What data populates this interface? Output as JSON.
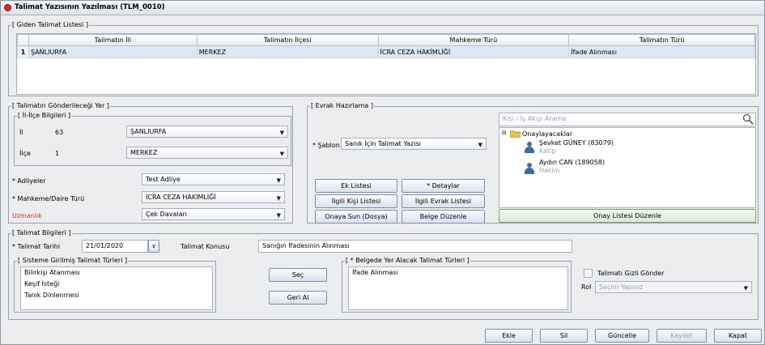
{
  "window": {
    "title": "Talimat Yazısının Yazılması (TLM_0010)"
  },
  "outgoing": {
    "title": "[ Giden Talimat Listesi ]",
    "columns": [
      "Talimatın İli",
      "Talimatın İlçesi",
      "Mahkeme Türü",
      "Talimatın Türü"
    ],
    "rows": [
      {
        "num": "1",
        "cells": [
          "ŞANLIURFA",
          "MERKEZ",
          "İCRA CEZA HAKİMLİĞİ",
          "İfade Alınması"
        ]
      }
    ]
  },
  "destination": {
    "title": "[ Talimatın Gönderileceği Yer ]",
    "ilce_group_title": "[ İl-İlçe Bilgileri ]",
    "il_label": "İl",
    "il_code": "63",
    "il_value": "ŞANLIURFA",
    "ilce_label": "İlçe",
    "ilce_code": "1",
    "ilce_value": "MERKEZ",
    "adliye_label": "* Adliyeler",
    "adliye_value": "Test Adliye",
    "mahkeme_label": "* Mahkeme/Daire Türü",
    "mahkeme_value": "İCRA CEZA HAKİMLİĞİ",
    "uzmanlik_label": "Uzmanlık",
    "uzmanlik_value": "Çek Davaları"
  },
  "evrak": {
    "title": "[ Evrak Hazırlama ]",
    "sablon_label": "* Şablon",
    "sablon_value": "Sanık İçin Talimat Yazısı",
    "buttons": {
      "ek_listesi": "Ek Listesi",
      "detaylar": "* Detaylar",
      "ilgili_kisi": "İlgili Kişi Listesi",
      "ilgili_evrak": "İlgili Evrak Listesi",
      "onaya_sun": "Onaya Sun (Dosya)",
      "belge_duzenle": "Belge Düzenle"
    },
    "search_placeholder": "Kişi / İş Akışı Arama",
    "tree": {
      "root": "Onaylayacaklar",
      "people": [
        {
          "name": "Şevket GÜNEY (83079)",
          "role": "Katip"
        },
        {
          "name": "Aydın CAN (189058)",
          "role": "Hakim"
        }
      ]
    },
    "onay_button": "Onay Listesi Düzenle"
  },
  "talimat": {
    "title": "[ Talimat Bilgileri ]",
    "tarih_label": "* Talimat Tarihi",
    "tarih_value": "21/01/2020",
    "konu_label": "Talimat Konusu",
    "konu_value": "Sanığın İfadesinin Alınması",
    "sistem_title": "[ Sisteme Girilmiş Talimat Türleri ]",
    "sistem_items": [
      "Bilirkişi Atanması",
      "Keşif İsteği",
      "Tanık Dinlenmesi"
    ],
    "sec_button": "Seç",
    "geri_al_button": "Geri Al",
    "belge_title": "[ * Belgede Yer Alacak Talimat Türleri ]",
    "belge_items": [
      "İfade Alınması"
    ],
    "gizli_label": "Talimatı Gizli Gönder",
    "rol_label": "Rol",
    "rol_placeholder": "Seçim Yapınız"
  },
  "footer": {
    "ekle": "Ekle",
    "sil": "Sil",
    "guncelle": "Güncelle",
    "kaydet": "Kaydet",
    "kapat": "Kapat"
  },
  "colors": {
    "selection": "#dce8f6",
    "accent": "#3a6ea5",
    "required_red": "#c0392b"
  }
}
